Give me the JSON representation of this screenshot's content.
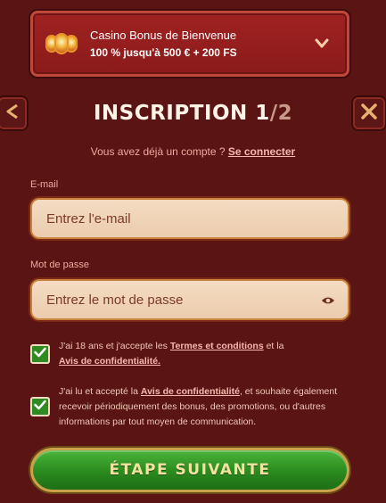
{
  "bonus": {
    "title": "Casino Bonus de Bienvenue",
    "subtitle": "100 % jusqu'à 500 € + 200 FS"
  },
  "header": {
    "title_main": "INSCRIPTION 1",
    "title_total": "/2"
  },
  "login": {
    "prompt": "Vous avez déjà un compte ? ",
    "link": "Se connecter"
  },
  "email": {
    "label": "E-mail",
    "placeholder": "Entrez l'e-mail",
    "value": ""
  },
  "password": {
    "label": "Mot de passe",
    "placeholder": "Entrez le mot de passe",
    "value": ""
  },
  "consent_terms": {
    "checked": true,
    "text_before": "J'ai 18 ans et j'accepte les ",
    "terms_link": "Termes et conditions",
    "text_middle": " et la",
    "privacy_link": "Avis de confidentialité."
  },
  "consent_marketing": {
    "checked": true,
    "text_before": "J'ai lu et accepté la ",
    "privacy_link": "Avis de confidentialité",
    "text_after": ", et souhaite également recevoir périodiquement des bonus, des promotions, ou d'autres informations par tout moyen de communication."
  },
  "next_button": {
    "label": "ÉTAPE SUIVANTE"
  },
  "icons": {
    "bonus": "slot-reels-icon",
    "expand": "chevron-down-icon",
    "back": "arrow-left-icon",
    "close": "close-icon",
    "password_toggle": "eye-icon",
    "checkbox": "checkmark-icon"
  },
  "colors": {
    "background": "#5a1414",
    "banner": "#9a1e1e",
    "input_bg": "#f0d4b8",
    "input_border": "#c8843e",
    "checkbox": "#2f8a22",
    "button": "#2f9a22",
    "button_border": "#c9a24a",
    "accent_text": "#f0a8a0"
  }
}
